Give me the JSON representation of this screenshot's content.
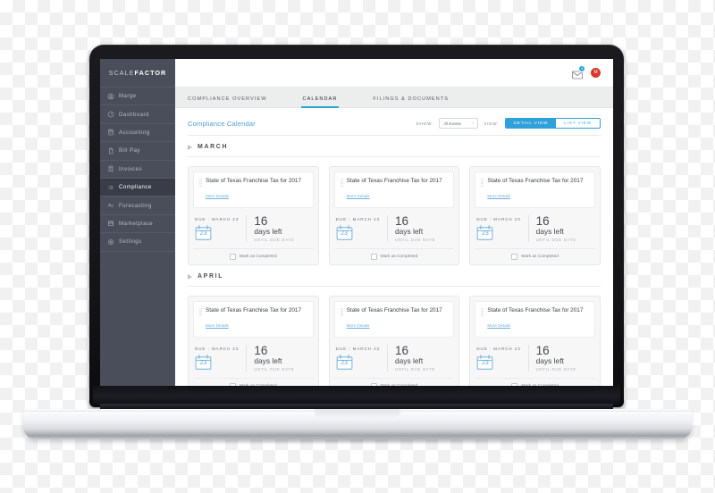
{
  "brand": {
    "light": "SCALE",
    "bold": "FACTOR"
  },
  "sidebar": {
    "items": [
      {
        "label": "Marge",
        "icon": "user-circle-icon",
        "active": false
      },
      {
        "label": "Dashboard",
        "icon": "speedometer-icon",
        "active": false
      },
      {
        "label": "Accounting",
        "icon": "calculator-icon",
        "active": false
      },
      {
        "label": "Bill Pay",
        "icon": "document-icon",
        "active": false
      },
      {
        "label": "Invoices",
        "icon": "invoice-icon",
        "active": false
      },
      {
        "label": "Compliance",
        "icon": "list-icon",
        "active": true
      },
      {
        "label": "Forecasting",
        "icon": "forecast-icon",
        "active": false
      },
      {
        "label": "Marketplace",
        "icon": "store-icon",
        "active": false
      },
      {
        "label": "Settings",
        "icon": "gear-icon",
        "active": false
      }
    ]
  },
  "topbar": {
    "mail_icon": "envelope-icon",
    "mail_badge": "4",
    "avatar_initials": "M",
    "accent": "#29a3e0",
    "avatar_color": "#d8372b"
  },
  "tabs": [
    {
      "label": "COMPLIANCE OVERVIEW",
      "active": false
    },
    {
      "label": "CALENDAR",
      "active": true
    },
    {
      "label": "FILINGS & DOCUMENTS",
      "active": false
    }
  ],
  "page": {
    "title": "Compliance Calendar",
    "title_color": "#4f9fd4",
    "show_label": "SHOW:",
    "show_value": "All Events",
    "view_label": "VIEW:",
    "view_options": [
      {
        "label": "DETAIL VIEW",
        "active": true
      },
      {
        "label": "LIST VIEW",
        "active": false
      }
    ]
  },
  "months": [
    {
      "name": "MARCH",
      "cards": [
        {
          "title": "State of Texas Franchise Tax for 2017",
          "more_label": "More Details",
          "due_label": "DUE : MARCH 23",
          "due_day": "23",
          "days_number": "16",
          "days_word": "days left",
          "days_sub": "UNTIL DUE DATE",
          "checkbox_label": "Mark as Completed",
          "checked": false
        },
        {
          "title": "State of Texas Franchise Tax for 2017",
          "more_label": "More Details",
          "due_label": "DUE : MARCH 23",
          "due_day": "23",
          "days_number": "16",
          "days_word": "days left",
          "days_sub": "UNTIL DUE DATE",
          "checkbox_label": "Mark as Completed",
          "checked": false
        },
        {
          "title": "State of Texas Franchise Tax for 2017",
          "more_label": "More Details",
          "due_label": "DUE : MARCH 23",
          "due_day": "23",
          "days_number": "16",
          "days_word": "days left",
          "days_sub": "UNTIL DUE DATE",
          "checkbox_label": "Mark as Completed",
          "checked": false
        }
      ]
    },
    {
      "name": "APRIL",
      "cards": [
        {
          "title": "State of Texas Franchise Tax for 2017",
          "more_label": "More Details",
          "due_label": "DUE : MARCH 23",
          "due_day": "23",
          "days_number": "16",
          "days_word": "days left",
          "days_sub": "UNTIL DUE DATE",
          "checkbox_label": "Mark as Completed",
          "checked": false
        },
        {
          "title": "State of Texas Franchise Tax for 2017",
          "more_label": "More Details",
          "due_label": "DUE : MARCH 23",
          "due_day": "23",
          "days_number": "16",
          "days_word": "days left",
          "days_sub": "UNTIL DUE DATE",
          "checkbox_label": "Mark as Completed",
          "checked": false
        },
        {
          "title": "State of Texas Franchise Tax for 2017",
          "more_label": "More Details",
          "due_label": "DUE : MARCH 23",
          "due_day": "23",
          "days_number": "16",
          "days_word": "days left",
          "days_sub": "UNTIL DUE DATE",
          "checkbox_label": "Mark as Completed",
          "checked": false
        }
      ]
    }
  ]
}
